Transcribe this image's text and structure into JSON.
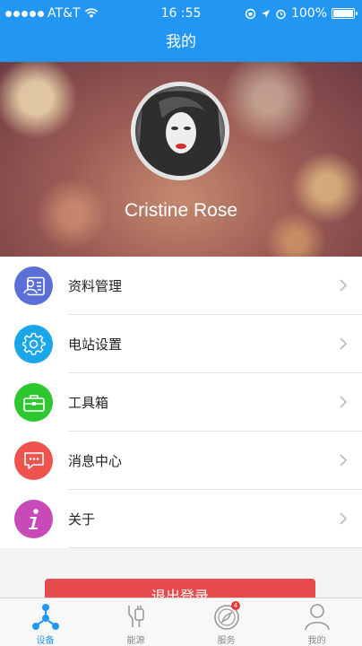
{
  "status_bar": {
    "carrier": "AT&T",
    "time": "16 :55",
    "battery": "100%",
    "battery_level": 1.0,
    "signal_dots": 5
  },
  "header": {
    "title": "我的"
  },
  "profile": {
    "name": "Cristine Rose"
  },
  "menu": {
    "items": [
      {
        "label": "资料管理",
        "icon": "profile-card-icon",
        "color": "#5b6fd6"
      },
      {
        "label": "电站设置",
        "icon": "gear-icon",
        "color": "#1aa6e8"
      },
      {
        "label": "工具箱",
        "icon": "toolbox-icon",
        "color": "#2fc72f"
      },
      {
        "label": "消息中心",
        "icon": "message-icon",
        "color": "#ef5350"
      },
      {
        "label": "关于",
        "icon": "info-icon",
        "color": "#c84ab8"
      }
    ]
  },
  "logout": {
    "label": "退出登录",
    "color": "#e74c4c"
  },
  "tabbar": {
    "active_color": "#2196f3",
    "tabs": [
      {
        "label": "设备",
        "icon": "device-network-icon",
        "active": true
      },
      {
        "label": "能源",
        "icon": "energy-plug-icon",
        "active": false
      },
      {
        "label": "服务",
        "icon": "service-compass-icon",
        "active": false,
        "badge": "4"
      },
      {
        "label": "我的",
        "icon": "user-icon",
        "active": false
      }
    ]
  }
}
